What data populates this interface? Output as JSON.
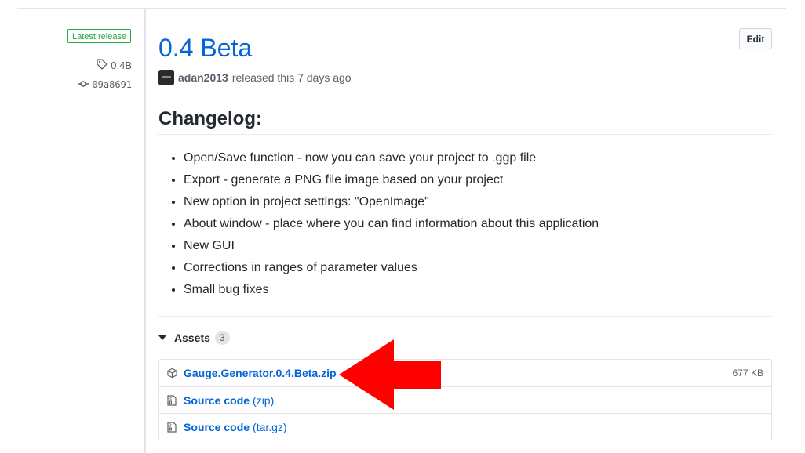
{
  "sidebar": {
    "badge": "Latest release",
    "tag": "0.4B",
    "commit": "09a8691"
  },
  "release": {
    "title": "0.4 Beta",
    "edit_label": "Edit",
    "author": "adan2013",
    "released_text": "released this 7 days ago"
  },
  "changelog": {
    "heading": "Changelog:",
    "items": [
      "Open/Save function - now you can save your project to .ggp file",
      "Export - generate a PNG file image based on your project",
      "New option in project settings: \"OpenImage\"",
      "About window - place where you can find information about this application",
      "New GUI",
      "Corrections in ranges of parameter values",
      "Small bug fixes"
    ]
  },
  "assets": {
    "label": "Assets",
    "count": "3",
    "files": [
      {
        "name": "Gauge.Generator.0.4.Beta.zip",
        "suffix": "",
        "size": "677 KB",
        "icon": "package-icon"
      },
      {
        "name": "Source code",
        "suffix": "(zip)",
        "size": "",
        "icon": "file-zip-icon"
      },
      {
        "name": "Source code",
        "suffix": "(tar.gz)",
        "size": "",
        "icon": "file-zip-icon"
      }
    ]
  },
  "colors": {
    "link": "#0366d6",
    "badge_green": "#28a745",
    "arrow_red": "#ff0000"
  }
}
